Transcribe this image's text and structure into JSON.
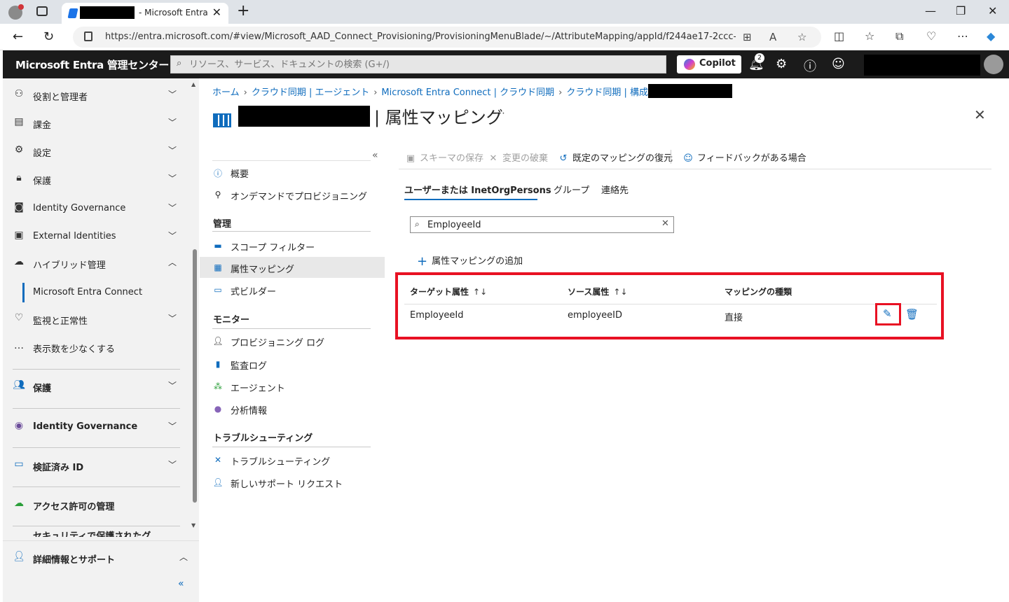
{
  "browser": {
    "tab_title": "- Microsoft Entra",
    "url": "https://entra.microsoft.com/#view/Microsoft_AAD_Connect_Provisioning/ProvisioningMenuBlade/~/AttributeMapping/appId/f244ae17-2ccc-4..."
  },
  "portal": {
    "brand": "Microsoft Entra 管理センター",
    "search_placeholder": "リソース、サービス、ドキュメントの検索 (G+/)",
    "copilot_label": "Copilot",
    "notification_count": "2"
  },
  "sidebar": {
    "items": [
      {
        "label": "役割と管理者",
        "icon": "role-icon"
      },
      {
        "label": "課金",
        "icon": "billing-icon"
      },
      {
        "label": "設定",
        "icon": "gear-icon"
      },
      {
        "label": "保護",
        "icon": "lock-icon"
      },
      {
        "label": "Identity Governance",
        "icon": "governance-icon"
      },
      {
        "label": "External Identities",
        "icon": "external-identities-icon"
      },
      {
        "label": "ハイブリッド管理",
        "icon": "hybrid-cloud-icon"
      },
      {
        "label": "Microsoft Entra Connect",
        "icon": ""
      },
      {
        "label": "監視と正常性",
        "icon": "heart-pulse-icon"
      },
      {
        "label": "表示数を少なくする",
        "icon": "ellipsis-icon"
      }
    ],
    "sections": [
      {
        "label": "保護",
        "icon": "users-icon"
      },
      {
        "label": "Identity Governance",
        "icon": "governance-icon"
      },
      {
        "label": "検証済み ID",
        "icon": "id-card-icon"
      },
      {
        "label": "アクセス許可の管理",
        "icon": "cloud-icon"
      },
      {
        "label": "セキュリティで保護されたグ",
        "icon": ""
      }
    ],
    "bottom": {
      "label": "詳細情報とサポート",
      "icon": "person-icon"
    }
  },
  "breadcrumb": [
    "ホーム",
    "クラウド同期 | エージェント",
    "Microsoft Entra Connect | クラウド同期",
    "クラウド同期 | 構成"
  ],
  "page": {
    "title": "| 属性マッピング"
  },
  "resource_menu": {
    "top": [
      {
        "label": "概要",
        "icon": "info-icon"
      },
      {
        "label": "オンデマンドでプロビジョニング",
        "icon": "provision-icon"
      }
    ],
    "groups": [
      {
        "header": "管理",
        "items": [
          {
            "label": "スコープ フィルター",
            "icon": "scope-filter-icon"
          },
          {
            "label": "属性マッピング",
            "icon": "table-icon"
          },
          {
            "label": "式ビルダー",
            "icon": "expression-icon"
          }
        ]
      },
      {
        "header": "モニター",
        "items": [
          {
            "label": "プロビジョニング ログ",
            "icon": "person-log-icon"
          },
          {
            "label": "監査ログ",
            "icon": "book-icon"
          },
          {
            "label": "エージェント",
            "icon": "network-icon"
          },
          {
            "label": "分析情報",
            "icon": "lightbulb-icon"
          }
        ]
      },
      {
        "header": "トラブルシューティング",
        "items": [
          {
            "label": "トラブルシューティング",
            "icon": "wrench-icon"
          },
          {
            "label": "新しいサポート リクエスト",
            "icon": "support-icon"
          }
        ]
      }
    ]
  },
  "toolbar": {
    "save": "スキーマの保存",
    "discard": "変更の破棄",
    "restore": "既定のマッピングの復元",
    "feedback": "フィードバックがある場合"
  },
  "tabs": [
    "ユーザーまたは InetOrgPersons",
    "グループ",
    "連絡先"
  ],
  "filter": {
    "value": "EmployeeId"
  },
  "add_mapping_label": "属性マッピングの追加",
  "table": {
    "headers": [
      "ターゲット属性",
      "ソース属性",
      "マッピングの種類"
    ],
    "rows": [
      {
        "target": "EmployeeId",
        "source": "employeeID",
        "type": "直接"
      }
    ]
  },
  "colors": {
    "accent": "#0f6cbd",
    "highlight": "#e81123",
    "header_bg": "#1b1b1b"
  }
}
